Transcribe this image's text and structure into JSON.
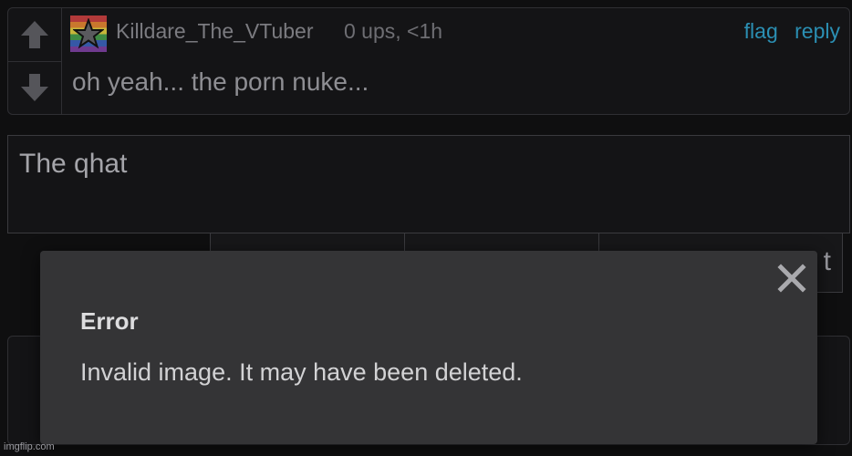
{
  "comment": {
    "username": "Killdare_The_VTuber",
    "meta": "0 ups, <1h",
    "actions": {
      "flag": "flag",
      "reply": "reply"
    },
    "text": "oh yeah... the porn nuke..."
  },
  "reply_box": {
    "value": "The qhat"
  },
  "buttons": {
    "third_label_partial": "t"
  },
  "dialog": {
    "title": "Error",
    "message": "Invalid image. It may have been deleted."
  },
  "watermark": "imgflip.com",
  "icons": {
    "upvote": "arrow-up-icon",
    "downvote": "arrow-down-icon",
    "avatar": "star-icon",
    "close": "close-icon"
  },
  "colors": {
    "background": "#0f0f10",
    "link": "#2b8fb3",
    "dialog": "#343436"
  }
}
